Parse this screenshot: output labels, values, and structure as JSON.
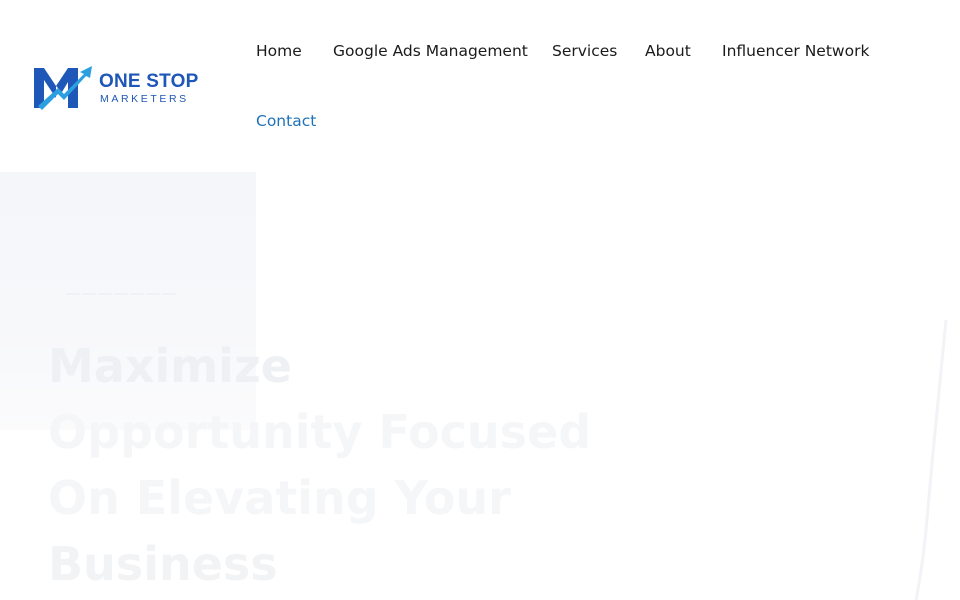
{
  "brand": {
    "title": "ONE STOP",
    "subtitle": "MARKETERS",
    "colors": {
      "primary": "#1f57b8",
      "accent": "#2b9fe0"
    }
  },
  "nav": {
    "items": [
      {
        "label": "Home"
      },
      {
        "label": "Google Ads Management"
      },
      {
        "label": "Services"
      },
      {
        "label": "About"
      },
      {
        "label": "Influencer Network"
      },
      {
        "label": "Contact"
      }
    ],
    "active_color": "#1f72b8"
  },
  "hero": {
    "lines": [
      "Maximize",
      "Opportunity Focused",
      "On Elevating Your",
      "Business"
    ]
  }
}
